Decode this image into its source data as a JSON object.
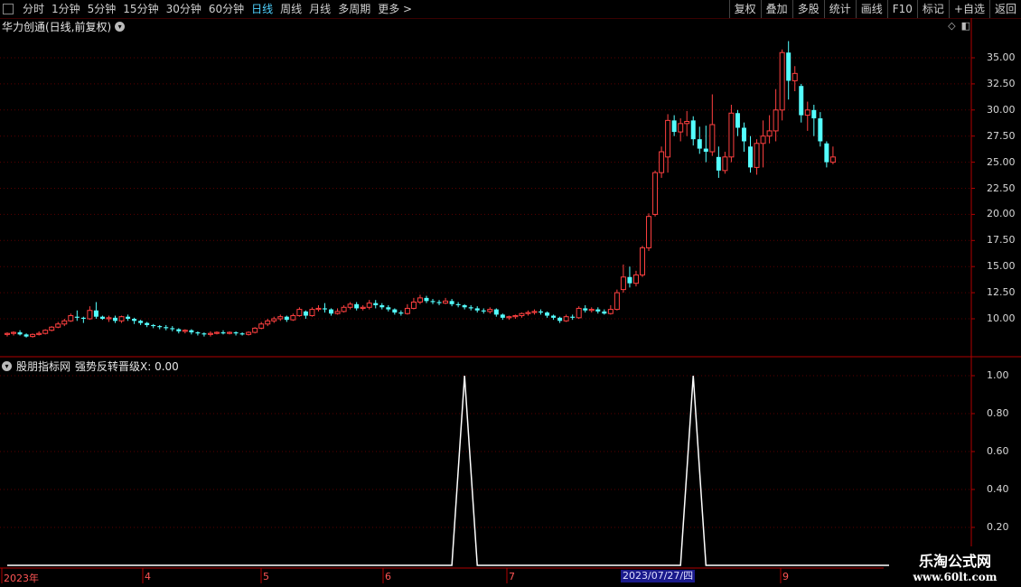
{
  "toolbar": {
    "periods": [
      "分时",
      "1分钟",
      "5分钟",
      "15分钟",
      "30分钟",
      "60分钟",
      "日线",
      "周线",
      "月线",
      "多周期",
      "更多 >"
    ],
    "active_period": "日线",
    "right_buttons": [
      "复权",
      "叠加",
      "多股",
      "统计",
      "画线",
      "F10",
      "标记",
      "+自选",
      "返回"
    ]
  },
  "main_title": "华力创通(日线,前复权)",
  "indicator": {
    "source": "股朋指标网",
    "label": "强势反转晋级X: 0.00"
  },
  "colors": {
    "up": "#ff4040",
    "down": "#54ffff",
    "grid": "#5a0000",
    "axis": "#b00000",
    "line": "#ffffff"
  },
  "price_axis": [
    "35.00",
    "32.50",
    "30.00",
    "27.50",
    "25.00",
    "22.50",
    "20.00",
    "17.50",
    "15.00",
    "12.50",
    "10.00"
  ],
  "indicator_axis": [
    "1.00",
    "0.80",
    "0.60",
    "0.40",
    "0.20"
  ],
  "date_axis": [
    "2023年",
    "4",
    "5",
    "6",
    "7",
    "9"
  ],
  "cursor_date": "2023/07/27/四",
  "watermark": {
    "line1": "乐淘公式网",
    "line2": "www.60lt.com"
  },
  "chart_data": {
    "type": "candlestick",
    "ylim": [
      8.0,
      37.0
    ],
    "candles": [
      [
        8.5,
        8.6,
        8.3,
        8.7
      ],
      [
        8.6,
        8.7,
        8.4,
        8.8
      ],
      [
        8.7,
        8.5,
        8.4,
        8.9
      ],
      [
        8.5,
        8.3,
        8.2,
        8.6
      ],
      [
        8.3,
        8.5,
        8.2,
        8.6
      ],
      [
        8.5,
        8.6,
        8.4,
        8.8
      ],
      [
        8.6,
        8.9,
        8.5,
        9.0
      ],
      [
        8.9,
        9.2,
        8.8,
        9.3
      ],
      [
        9.2,
        9.5,
        9.1,
        9.7
      ],
      [
        9.5,
        9.8,
        9.3,
        10.0
      ],
      [
        9.8,
        10.3,
        9.7,
        10.5
      ],
      [
        10.2,
        10.1,
        9.8,
        10.8
      ],
      [
        10.1,
        10.0,
        9.6,
        10.2
      ],
      [
        10.0,
        10.8,
        9.9,
        11.2
      ],
      [
        10.8,
        10.2,
        10.0,
        11.6
      ],
      [
        10.2,
        10.0,
        9.9,
        10.3
      ],
      [
        10.0,
        10.1,
        9.7,
        10.3
      ],
      [
        10.1,
        9.8,
        9.6,
        10.3
      ],
      [
        9.8,
        10.2,
        9.6,
        10.3
      ],
      [
        10.2,
        10.0,
        9.8,
        10.4
      ],
      [
        10.0,
        9.8,
        9.5,
        10.1
      ],
      [
        9.8,
        9.6,
        9.4,
        9.9
      ],
      [
        9.6,
        9.4,
        9.2,
        9.7
      ],
      [
        9.4,
        9.3,
        9.1,
        9.5
      ],
      [
        9.3,
        9.2,
        9.0,
        9.4
      ],
      [
        9.2,
        9.1,
        8.9,
        9.4
      ],
      [
        9.1,
        9.0,
        8.8,
        9.3
      ],
      [
        9.0,
        8.8,
        8.6,
        9.1
      ],
      [
        8.8,
        8.9,
        8.6,
        9.0
      ],
      [
        8.9,
        8.7,
        8.5,
        9.0
      ],
      [
        8.7,
        8.6,
        8.4,
        8.8
      ],
      [
        8.6,
        8.5,
        8.3,
        8.7
      ],
      [
        8.5,
        8.6,
        8.3,
        8.8
      ],
      [
        8.6,
        8.7,
        8.5,
        8.8
      ],
      [
        8.7,
        8.6,
        8.5,
        8.9
      ],
      [
        8.6,
        8.7,
        8.5,
        8.8
      ],
      [
        8.7,
        8.6,
        8.4,
        8.8
      ],
      [
        8.6,
        8.5,
        8.4,
        8.7
      ],
      [
        8.5,
        8.7,
        8.4,
        8.8
      ],
      [
        8.7,
        9.1,
        8.6,
        9.2
      ],
      [
        9.1,
        9.5,
        9.0,
        9.7
      ],
      [
        9.5,
        9.8,
        9.3,
        10.0
      ],
      [
        9.8,
        10.0,
        9.6,
        10.2
      ],
      [
        10.0,
        10.2,
        9.8,
        10.4
      ],
      [
        10.2,
        9.9,
        9.7,
        10.3
      ],
      [
        9.9,
        10.3,
        9.8,
        10.5
      ],
      [
        10.3,
        10.9,
        10.2,
        11.1
      ],
      [
        10.7,
        10.3,
        10.0,
        10.8
      ],
      [
        10.3,
        10.9,
        10.2,
        11.1
      ],
      [
        10.9,
        11.0,
        10.7,
        11.3
      ],
      [
        11.0,
        10.9,
        10.6,
        11.5
      ],
      [
        10.9,
        10.5,
        10.3,
        11.0
      ],
      [
        10.5,
        10.7,
        10.4,
        11.0
      ],
      [
        10.7,
        11.1,
        10.6,
        11.3
      ],
      [
        11.1,
        11.4,
        10.9,
        11.6
      ],
      [
        11.4,
        11.0,
        10.8,
        11.6
      ],
      [
        11.0,
        11.1,
        10.8,
        11.3
      ],
      [
        11.1,
        11.5,
        10.9,
        11.8
      ],
      [
        11.5,
        11.3,
        11.0,
        11.8
      ],
      [
        11.3,
        11.1,
        10.9,
        11.5
      ],
      [
        11.1,
        10.9,
        10.7,
        11.3
      ],
      [
        10.9,
        10.6,
        10.4,
        11.0
      ],
      [
        10.6,
        10.5,
        10.3,
        10.8
      ],
      [
        10.5,
        11.0,
        10.4,
        11.4
      ],
      [
        11.0,
        11.6,
        10.9,
        12.0
      ],
      [
        11.6,
        12.0,
        11.4,
        12.3
      ],
      [
        12.0,
        11.7,
        11.5,
        12.2
      ],
      [
        11.7,
        11.6,
        11.4,
        11.9
      ],
      [
        11.6,
        11.5,
        11.3,
        11.8
      ],
      [
        11.5,
        11.7,
        11.4,
        12.0
      ],
      [
        11.7,
        11.4,
        11.2,
        11.9
      ],
      [
        11.4,
        11.3,
        11.1,
        11.6
      ],
      [
        11.3,
        11.1,
        10.9,
        11.4
      ],
      [
        11.1,
        11.0,
        10.8,
        11.3
      ],
      [
        11.0,
        10.8,
        10.6,
        11.2
      ],
      [
        10.8,
        10.7,
        10.5,
        11.0
      ],
      [
        10.7,
        10.9,
        10.5,
        11.1
      ],
      [
        10.9,
        10.4,
        10.2,
        11.0
      ],
      [
        10.4,
        10.1,
        9.9,
        10.5
      ],
      [
        10.1,
        10.2,
        9.9,
        10.3
      ],
      [
        10.2,
        10.3,
        10.0,
        10.4
      ],
      [
        10.3,
        10.5,
        10.1,
        10.6
      ],
      [
        10.5,
        10.6,
        10.3,
        10.8
      ],
      [
        10.6,
        10.7,
        10.4,
        10.9
      ],
      [
        10.7,
        10.6,
        10.4,
        10.9
      ],
      [
        10.6,
        10.3,
        10.1,
        10.7
      ],
      [
        10.3,
        10.1,
        9.9,
        10.4
      ],
      [
        10.1,
        9.8,
        9.6,
        10.2
      ],
      [
        9.8,
        10.2,
        9.7,
        10.4
      ],
      [
        10.2,
        10.1,
        9.9,
        10.4
      ],
      [
        10.1,
        11.0,
        10.0,
        11.2
      ],
      [
        11.0,
        10.8,
        10.6,
        11.3
      ],
      [
        10.8,
        10.9,
        10.6,
        11.1
      ],
      [
        10.9,
        10.7,
        10.5,
        11.1
      ],
      [
        10.7,
        10.5,
        10.4,
        10.9
      ],
      [
        10.5,
        10.9,
        10.4,
        11.3
      ],
      [
        10.9,
        12.5,
        10.8,
        12.8
      ],
      [
        12.8,
        14.0,
        12.5,
        15.2
      ],
      [
        14.0,
        13.4,
        13.0,
        15.0
      ],
      [
        13.4,
        14.2,
        13.1,
        14.6
      ],
      [
        14.2,
        16.8,
        14.0,
        17.0
      ],
      [
        16.8,
        19.8,
        16.5,
        20.1
      ],
      [
        20.0,
        24.0,
        19.8,
        24.2
      ],
      [
        24.0,
        26.0,
        23.5,
        26.5
      ],
      [
        25.5,
        29.0,
        24.0,
        29.6
      ],
      [
        29.0,
        27.9,
        27.5,
        29.5
      ],
      [
        27.9,
        28.7,
        27.0,
        29.2
      ],
      [
        28.7,
        28.9,
        27.5,
        29.9
      ],
      [
        29.0,
        27.2,
        26.6,
        29.4
      ],
      [
        27.2,
        26.3,
        25.8,
        28.4
      ],
      [
        26.3,
        26.0,
        25.0,
        28.5
      ],
      [
        26.0,
        28.6,
        25.6,
        31.5
      ],
      [
        25.5,
        24.2,
        23.5,
        26.5
      ],
      [
        24.2,
        25.5,
        23.9,
        26.0
      ],
      [
        25.5,
        29.7,
        25.0,
        30.5
      ],
      [
        29.7,
        28.3,
        27.5,
        30.0
      ],
      [
        28.3,
        27.0,
        26.0,
        28.8
      ],
      [
        26.5,
        24.5,
        24.0,
        27.5
      ],
      [
        24.5,
        26.8,
        23.8,
        27.2
      ],
      [
        26.8,
        27.5,
        24.5,
        29.0
      ],
      [
        27.5,
        28.0,
        26.8,
        29.5
      ],
      [
        28.0,
        30.0,
        27.0,
        32.0
      ],
      [
        30.0,
        35.5,
        29.0,
        35.8
      ],
      [
        35.5,
        32.8,
        31.0,
        36.6
      ],
      [
        32.8,
        33.5,
        31.8,
        34.2
      ],
      [
        32.3,
        29.5,
        28.8,
        32.5
      ],
      [
        29.5,
        30.0,
        28.0,
        30.8
      ],
      [
        30.0,
        29.2,
        27.5,
        30.5
      ],
      [
        29.2,
        27.0,
        26.5,
        29.8
      ],
      [
        26.8,
        25.0,
        24.5,
        27.0
      ],
      [
        25.0,
        25.5,
        24.8,
        26.5
      ]
    ],
    "indicator_series": [
      [
        0,
        0
      ],
      [
        70,
        0
      ],
      [
        72,
        1
      ],
      [
        74,
        0
      ],
      [
        106,
        0
      ],
      [
        108,
        1
      ],
      [
        110,
        0
      ],
      [
        149,
        0
      ]
    ],
    "indicator_ylim": [
      0.0,
      1.1
    ]
  }
}
